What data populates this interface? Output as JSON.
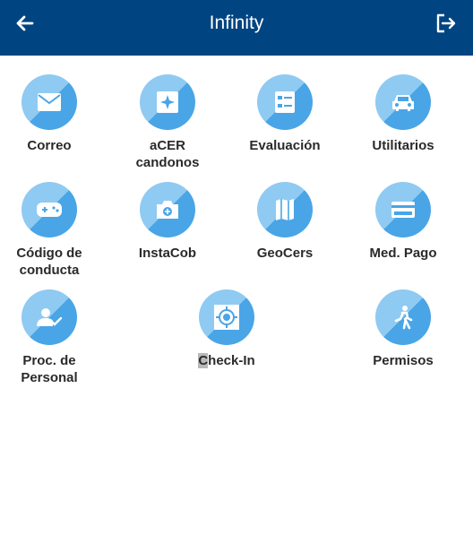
{
  "header": {
    "title": "Infinity",
    "back_icon": "arrow-left-icon",
    "logout_icon": "logout-icon",
    "background": "#004481"
  },
  "tiles": [
    {
      "name": "correo",
      "icon": "mail-icon",
      "label_lines": [
        "Correo"
      ]
    },
    {
      "name": "acer",
      "icon": "acer-icon",
      "label_lines": [
        "aCER",
        "candonos"
      ]
    },
    {
      "name": "evaluacion",
      "icon": "checklist-icon",
      "label_lines": [
        "Evaluación"
      ]
    },
    {
      "name": "utilitarios",
      "icon": "car-icon",
      "label_lines": [
        "Utilitarios"
      ]
    },
    {
      "name": "codigo-conducta",
      "icon": "gamepad-icon",
      "label_lines": [
        "Código de",
        "conducta"
      ]
    },
    {
      "name": "instacob",
      "icon": "camera-icon",
      "label_lines": [
        "InstaCob"
      ]
    },
    {
      "name": "geocers",
      "icon": "map-icon",
      "label_lines": [
        "GeoCers"
      ]
    },
    {
      "name": "med-pago",
      "icon": "credit-card-icon",
      "label_lines": [
        "Med. Pago"
      ]
    },
    {
      "name": "proc-personal",
      "icon": "user-check-icon",
      "label_lines": [
        "Proc. de",
        "Personal"
      ]
    },
    {
      "name": "check-in",
      "icon": "target-icon",
      "label_highlight": "C",
      "label_rest": "heck-In"
    },
    {
      "name": "permisos",
      "icon": "walking-person-icon",
      "label_lines": [
        "Permisos"
      ]
    }
  ],
  "colors": {
    "circle_light": "#8fcaf2",
    "circle_dark": "#49a5e6",
    "label": "#2a2a2a"
  }
}
